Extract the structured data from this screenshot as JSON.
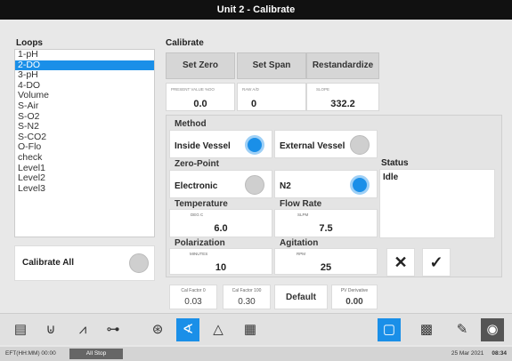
{
  "window": {
    "title": "Unit 2 - Calibrate"
  },
  "loops": {
    "label": "Loops",
    "items": [
      "1-pH",
      "2-DO",
      "3-pH",
      "4-DO",
      "Volume",
      "S-Air",
      "S-O2",
      "S-N2",
      "S-CO2",
      "O-Flo",
      "check",
      "Level1",
      "Level2",
      "Level3"
    ],
    "selected": "2-DO"
  },
  "calibrate_all": {
    "label": "Calibrate All",
    "state": "off"
  },
  "calibrate": {
    "title": "Calibrate",
    "set_zero": "Set Zero",
    "set_span": "Set Span",
    "restandardize": "Restandardize",
    "present_value": {
      "caption": "PRESENT VALUE %DO",
      "value": "0.0"
    },
    "raw_ad": {
      "caption": "RAW A/D",
      "value": "0"
    },
    "slope": {
      "caption": "SLOPE",
      "value": "332.2"
    }
  },
  "method": {
    "label": "Method",
    "inside_vessel": {
      "label": "Inside Vessel",
      "state": "on"
    },
    "external_vessel": {
      "label": "External Vessel",
      "state": "off"
    }
  },
  "zero_point": {
    "label": "Zero-Point",
    "electronic": {
      "label": "Electronic",
      "state": "off"
    },
    "n2": {
      "label": "N2",
      "state": "on"
    }
  },
  "status": {
    "label": "Status",
    "value": "Idle"
  },
  "temperature": {
    "label": "Temperature",
    "unit": "DEG C",
    "value": "6.0"
  },
  "flow_rate": {
    "label": "Flow Rate",
    "unit": "SLPM",
    "value": "7.5"
  },
  "polarization": {
    "label": "Polarization",
    "unit": "MINUTES",
    "value": "10"
  },
  "agitation": {
    "label": "Agitation",
    "unit": "RPM",
    "value": "25"
  },
  "footer": {
    "cal_factor_0": {
      "caption": "Cal Factor 0",
      "value": "0.03"
    },
    "cal_factor_100": {
      "caption": "Cal Factor 100",
      "value": "0.30"
    },
    "default_label": "Default",
    "pv_derivative": {
      "caption": "PV Derivative",
      "value": "0.00"
    }
  },
  "statusbar": {
    "eft": "EFT(HH:MM) 00:00",
    "all_stop": "All Stop",
    "date": "25 Mar 2021",
    "time": "08:34"
  },
  "accent": "#1a8fe8"
}
